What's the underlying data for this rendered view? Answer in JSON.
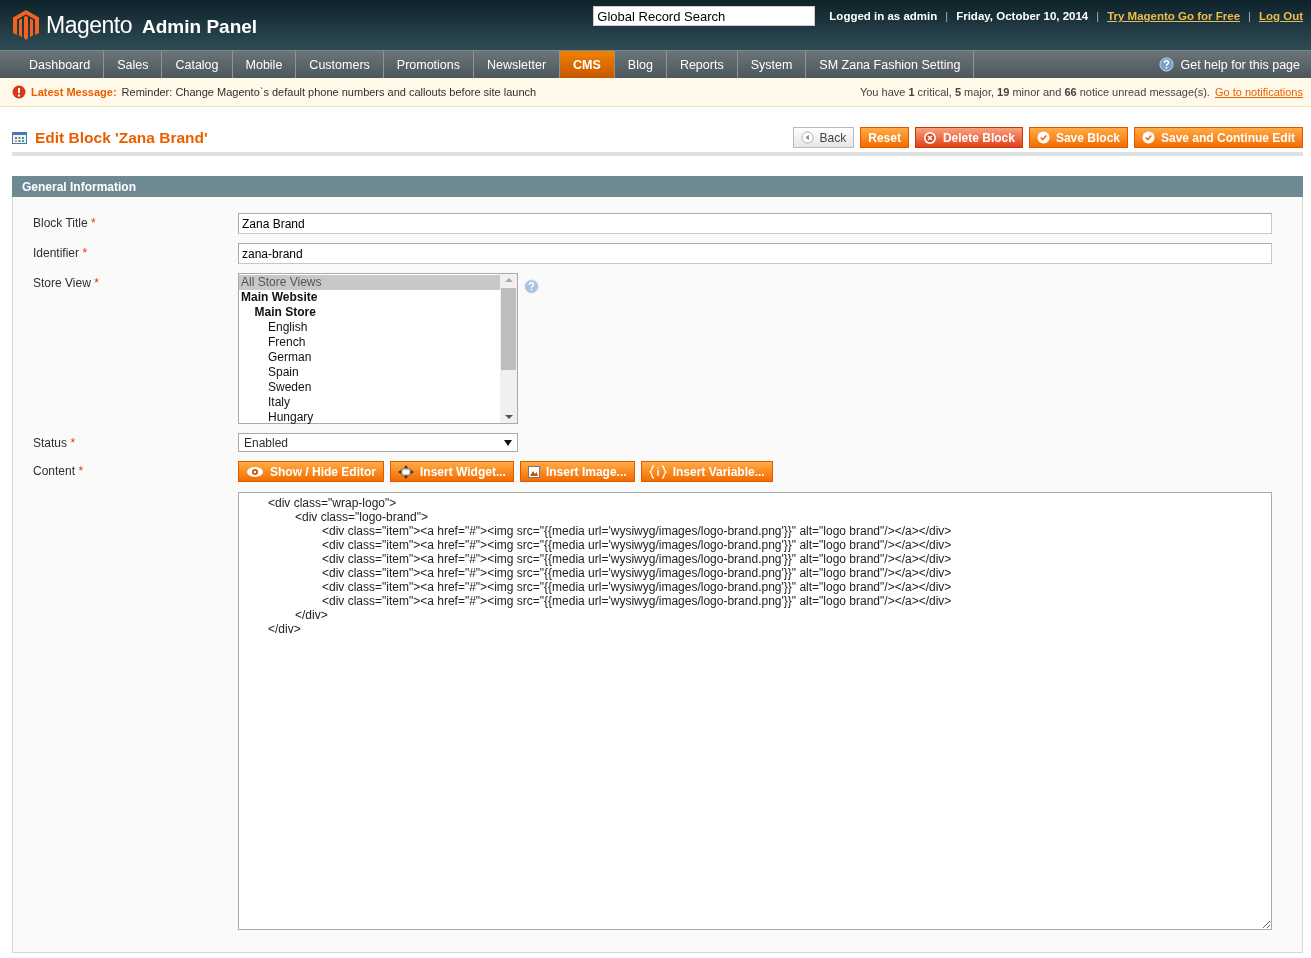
{
  "header": {
    "logo_word": "Magento",
    "logo_sub": "Admin Panel",
    "search": {
      "value": "Global Record Search"
    },
    "items": [
      {
        "kind": "text",
        "text": "Logged in as admin"
      },
      {
        "kind": "separator",
        "text": "|"
      },
      {
        "kind": "text",
        "text": "Friday, October 10, 2014"
      },
      {
        "kind": "separator",
        "text": "|"
      },
      {
        "kind": "link",
        "text": "Try Magento Go for Free"
      },
      {
        "kind": "separator",
        "text": "|"
      },
      {
        "kind": "link",
        "text": "Log Out"
      }
    ]
  },
  "nav": {
    "items": [
      {
        "label": "Dashboard",
        "selected": false
      },
      {
        "label": "Sales",
        "selected": false
      },
      {
        "label": "Catalog",
        "selected": false
      },
      {
        "label": "Mobile",
        "selected": false
      },
      {
        "label": "Customers",
        "selected": false
      },
      {
        "label": "Promotions",
        "selected": false
      },
      {
        "label": "Newsletter",
        "selected": false
      },
      {
        "label": "CMS",
        "selected": true
      },
      {
        "label": "Blog",
        "selected": false
      },
      {
        "label": "Reports",
        "selected": false
      },
      {
        "label": "System",
        "selected": false
      },
      {
        "label": "SM Zana Fashion Setting",
        "selected": false
      }
    ],
    "help": "Get help for this page"
  },
  "message": {
    "label": "Latest Message:",
    "text": "Reminder: Change Magento`s default phone numbers and callouts before site launch",
    "summary": "You have **1** critical, **5** major, **19** minor and **66** notice unread message(s).",
    "link": "Go to notifications"
  },
  "page": {
    "title": "Edit Block 'Zana Brand'",
    "actions": [
      {
        "label": "Back",
        "kind": "back"
      },
      {
        "label": "Reset",
        "kind": "reset"
      },
      {
        "label": "Delete Block",
        "kind": "delete"
      },
      {
        "label": "Save Block",
        "kind": "save"
      },
      {
        "label": "Save and Continue Edit",
        "kind": "save"
      }
    ]
  },
  "section": {
    "title": "General Information",
    "required_mark": "*",
    "fields": [
      {
        "kind": "text",
        "label": "Block Title",
        "required": true,
        "value": "Zana Brand"
      },
      {
        "kind": "text",
        "label": "Identifier",
        "required": true,
        "value": "zana-brand"
      },
      {
        "kind": "multiselect",
        "label": "Store View",
        "required": true,
        "options": [
          {
            "label": "All Store Views",
            "selected": true
          },
          {
            "label": "Main Website",
            "selected": false,
            "children": [
              {
                "label": "Main Store",
                "selected": false,
                "children": [
                  {
                    "label": "English",
                    "selected": false
                  },
                  {
                    "label": "French",
                    "selected": false
                  },
                  {
                    "label": "German",
                    "selected": false
                  },
                  {
                    "label": "Spain",
                    "selected": false
                  },
                  {
                    "label": "Sweden",
                    "selected": false
                  },
                  {
                    "label": "Italy",
                    "selected": false
                  },
                  {
                    "label": "Hungary",
                    "selected": false
                  }
                ]
              }
            ]
          }
        ]
      },
      {
        "kind": "select",
        "label": "Status",
        "required": true,
        "value": "Enabled"
      },
      {
        "kind": "editor",
        "label": "Content",
        "required": true,
        "buttons": [
          {
            "label": "Show / Hide Editor",
            "kind": "toggle"
          },
          {
            "label": "Insert Widget...",
            "kind": "widget"
          },
          {
            "label": "Insert Image...",
            "kind": "image"
          },
          {
            "label": "Insert Variable...",
            "kind": "variable"
          }
        ],
        "value": "\t<div class=\"wrap-logo\">\n\t\t<div class=\"logo-brand\">\n\t\t\t<div class=\"item\"><a href=\"#\"><img src=\"{{media url='wysiwyg/images/logo-brand.png'}}\" alt=\"logo brand\"/></a></div>\n\t\t\t<div class=\"item\"><a href=\"#\"><img src=\"{{media url='wysiwyg/images/logo-brand.png'}}\" alt=\"logo brand\"/></a></div>\n\t\t\t<div class=\"item\"><a href=\"#\"><img src=\"{{media url='wysiwyg/images/logo-brand.png'}}\" alt=\"logo brand\"/></a></div>\n\t\t\t<div class=\"item\"><a href=\"#\"><img src=\"{{media url='wysiwyg/images/logo-brand.png'}}\" alt=\"logo brand\"/></a></div>\n\t\t\t<div class=\"item\"><a href=\"#\"><img src=\"{{media url='wysiwyg/images/logo-brand.png'}}\" alt=\"logo brand\"/></a></div>\n\t\t\t<div class=\"item\"><a href=\"#\"><img src=\"{{media url='wysiwyg/images/logo-brand.png'}}\" alt=\"logo brand\"/></a></div>\n\t\t</div>\n\t</div>"
      }
    ]
  }
}
